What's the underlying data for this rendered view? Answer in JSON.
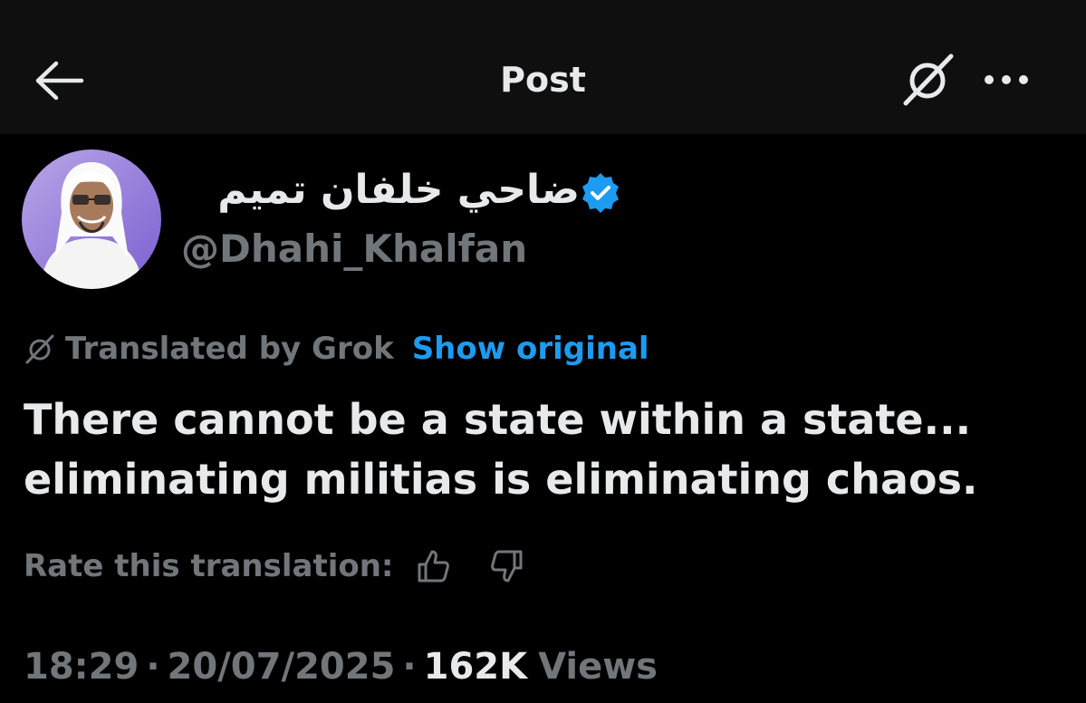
{
  "header": {
    "title": "Post",
    "back_icon": "arrow-left-icon",
    "grok_icon": "grok-icon",
    "more_icon": "more-horizontal-icon"
  },
  "author": {
    "name": "ضاحي خلفان تميم",
    "handle": "@Dhahi_Khalfan",
    "verified": true,
    "avatar_icon": "avatar"
  },
  "translation": {
    "label": "Translated by Grok",
    "show_original": "Show original"
  },
  "post": {
    "text_line1": "There cannot be a state within a state...",
    "text_line2": "eliminating militias is eliminating chaos."
  },
  "rating": {
    "label": "Rate this translation:",
    "thumbs_up_icon": "thumbs-up-icon",
    "thumbs_down_icon": "thumbs-down-icon"
  },
  "meta": {
    "time": "18:29",
    "date": "20/07/2025",
    "separator": "·",
    "views_count": "162K",
    "views_label": "Views"
  },
  "colors": {
    "background": "#000000",
    "header_background": "#0f0f0f",
    "primary_text": "#e7e9ea",
    "muted_text": "#71767b",
    "accent": "#1d9bf0"
  }
}
